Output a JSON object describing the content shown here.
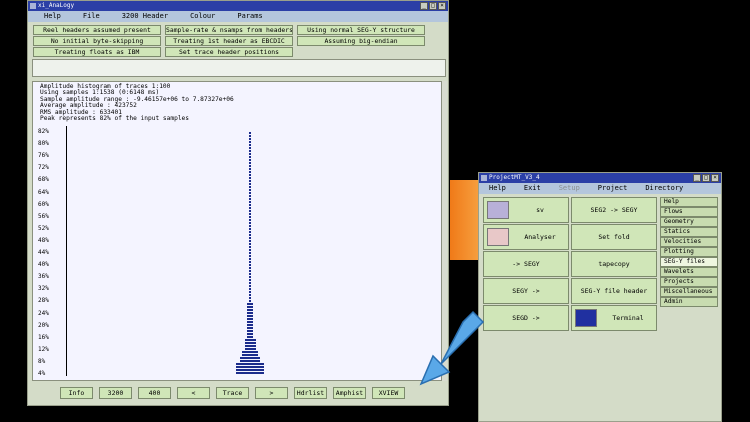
{
  "win1": {
    "title": "xi_AnaLogy",
    "menu": [
      "Help",
      "File",
      "3200 Header",
      "Colour",
      "Params"
    ],
    "buttons": [
      "Reel headers assumed present",
      "Sample-rate & nsamps from headers",
      "Using normal SEG-Y structure",
      "No initial byte-skipping",
      "Treating 1st header as EBCDIC",
      "Assuming big-endian",
      "Treating floats as IBM",
      "Set trace header positions"
    ],
    "info_lines": [
      "Amplitude histogram of traces 1:100",
      "Using samples 1:1538 (0:6148 ms)",
      "Sample amplitude range : -9.46157e+06 to 7.87327e+06",
      "Average amplitude : 423752",
      "RMS amplitude      : 633401",
      "Peak represents 82% of the input samples"
    ],
    "y_labels": [
      "82%",
      "80%",
      "76%",
      "72%",
      "68%",
      "64%",
      "60%",
      "56%",
      "52%",
      "48%",
      "44%",
      "40%",
      "36%",
      "32%",
      "28%",
      "24%",
      "20%",
      "16%",
      "12%",
      "8%",
      "4%"
    ],
    "bottom_buttons": [
      "Info",
      "3200",
      "400",
      "<",
      "Trace",
      ">",
      "Hdrlist",
      "Amphist",
      "XVIEW"
    ]
  },
  "win2": {
    "title": "ProjectMT_V3_4",
    "menu": [
      "Help",
      "Exit",
      "Setup",
      "Project",
      "Directory"
    ],
    "tiles": [
      {
        "label": "sv",
        "thumb": "thumb-seismic"
      },
      {
        "label": "SEG2 -> SEGY",
        "thumb": ""
      },
      {
        "label": "Analyser",
        "thumb": "thumb-chart"
      },
      {
        "label": "Set fold",
        "thumb": ""
      },
      {
        "label": "-> SEGY",
        "thumb": ""
      },
      {
        "label": "tapecopy",
        "thumb": ""
      },
      {
        "label": "SEGY ->",
        "thumb": ""
      },
      {
        "label": "SEG-Y file header",
        "thumb": ""
      },
      {
        "label": "SEGD ->",
        "thumb": ""
      },
      {
        "label": "Terminal",
        "thumb": "thumb-terminal"
      }
    ],
    "side_items": [
      "Help",
      "Flows",
      "Geometry",
      "Statics",
      "Velocities",
      "Plotting",
      "SEG-Y files",
      "Wavelets",
      "Projects",
      "Miscellaneous",
      "Admin"
    ],
    "selected_side": "SEG-Y files"
  },
  "histogram": {
    "ymax_percent": 82,
    "rows": [
      {
        "level_percent": 82,
        "width": 1
      },
      {
        "level_percent": 4,
        "width": 13
      },
      {
        "level_percent": 6,
        "width": 9
      },
      {
        "level_percent": 8,
        "width": 7
      },
      {
        "level_percent": 12,
        "width": 5
      },
      {
        "level_percent": 24,
        "width": 3
      }
    ]
  },
  "colors": {
    "accent_title": "#2b3fa6",
    "button": "#d0e6b8",
    "histogram": "#1b2c8c"
  }
}
